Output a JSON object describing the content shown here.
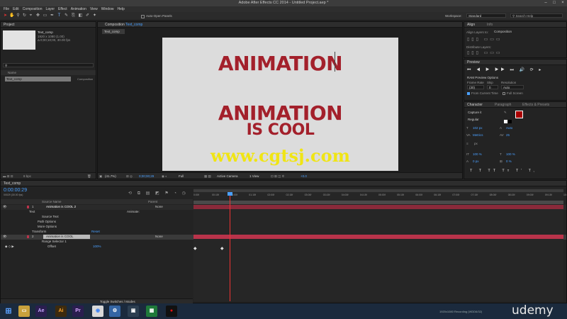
{
  "window": {
    "title": "Adobe After Effects CC 2014 - Untitled Project.aep *"
  },
  "menu": [
    "File",
    "Edit",
    "Composition",
    "Layer",
    "Effect",
    "Animation",
    "View",
    "Window",
    "Help"
  ],
  "toolbar": {
    "auto_open_panels": "Auto-Open Panels",
    "workspace_label": "Workspace:",
    "workspace_value": "Standard",
    "search_help": "Search Help"
  },
  "project": {
    "tab": "Project",
    "comp_name": "Text_comp",
    "comp_info1": "1920 x 1080 (1.00)",
    "comp_info2": "Δ 0;00;10;00, 30.00 fps",
    "col_name": "Name",
    "item_name": "Text_comp",
    "item_type": "Composition",
    "bpc": "8 bpc"
  },
  "composition": {
    "tab_label": "Composition",
    "tab_name": "Text_comp",
    "sub_tab": "Text_comp",
    "line1": "ANIMATION",
    "line2": "ANIMATION",
    "line3": "IS COOL",
    "watermark": "www.cgtsj.com",
    "zoom": "(41.7%)",
    "timecode": "0;00;00;29",
    "resolution": "Full",
    "camera": "Active Camera",
    "views": "1 View",
    "offset": "+0.0"
  },
  "align": {
    "tab": "Align",
    "tab2": "Info",
    "align_to_label": "Align Layers to:",
    "align_to_value": "Composition",
    "distribute": "Distribute Layers:"
  },
  "preview": {
    "tab": "Preview",
    "ram_options": "RAM Preview Options",
    "frame_rate_label": "Frame Rate",
    "skip_label": "Skip",
    "resolution_label": "Resolution",
    "frame_rate": "(30)",
    "skip": "0",
    "resolution": "Auto",
    "from_current": "From Current Time",
    "full_screen": "Full Screen"
  },
  "character": {
    "tab": "Character",
    "tab2": "Paragraph",
    "tab3": "Effects & Presets",
    "font": "Capture it",
    "style": "Regular",
    "font_size": "102 px",
    "leading": "Auto",
    "kerning": "Metrics",
    "tracking": "25",
    "stroke": "px",
    "vscale": "100 %",
    "hscale": "100 %",
    "baseline": "0 px",
    "tsume": "0 %"
  },
  "timeline": {
    "tab": "Text_comp",
    "timecode": "0:00:00:29",
    "fps_info": "00029 (30.00 fps)",
    "col_source": "Source Name",
    "col_parent": "Parent",
    "ticks": [
      "0:00f",
      "00:15f",
      "01:00f",
      "01:15f",
      "02:00f",
      "02:15f",
      "03:00f",
      "03:15f",
      "04:00f",
      "04:15f",
      "05:00f",
      "05:15f",
      "06:00f",
      "06:15f",
      "07:00f",
      "07:15f",
      "08:00f",
      "08:15f",
      "09:00f",
      "09:15f",
      "10:0"
    ],
    "layers": [
      {
        "num": "1",
        "name": "Animation is COOL 2",
        "parent": "None"
      },
      {
        "name": "Text",
        "animate": "Animate:"
      },
      {
        "name": "Source Text"
      },
      {
        "name": "Path Options"
      },
      {
        "name": "More Options"
      },
      {
        "name": "Transform",
        "link": "Reset"
      },
      {
        "num": "2",
        "name": "Animation is COOL",
        "parent": "None"
      },
      {
        "name": "Range Selector 1"
      },
      {
        "name": "Offset",
        "value": "100%"
      }
    ],
    "toggle": "Toggle Switches / Modes"
  },
  "taskbar": {
    "apps": [
      "Ae",
      "Ai",
      "Pr"
    ],
    "brand": "udemy",
    "status": "1920x1080  Recording (WDD6/32)"
  },
  "colors": {
    "accent": "#4aa0ff",
    "red_text": "#a3202b",
    "layer_bar": "#b9334a",
    "watermark": "#f0e514",
    "playhead": "#e33"
  }
}
